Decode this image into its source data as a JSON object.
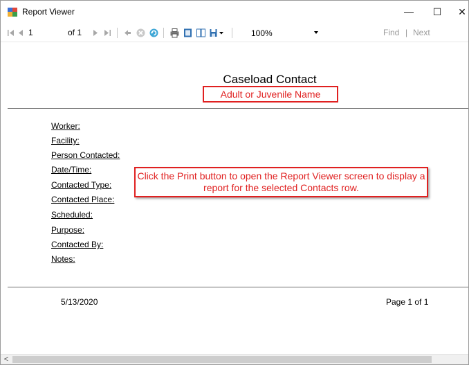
{
  "window": {
    "title": "Report Viewer",
    "minimize_glyph": "—",
    "maximize_glyph": "☐",
    "close_glyph": "✕"
  },
  "toolbar": {
    "first_page_icon": "first-page-icon",
    "prev_page_icon": "previous-page-icon",
    "current_page": "1",
    "of_pages": "of 1",
    "next_page_icon": "next-page-icon",
    "last_page_icon": "last-page-icon",
    "back_icon": "back-icon",
    "stop_icon": "stop-icon",
    "refresh_icon": "refresh-icon",
    "print_icon": "print-icon",
    "print_layout_icon": "print-layout-icon",
    "page_setup_icon": "page-setup-icon",
    "export_icon": "export-icon",
    "zoom": "100%",
    "find_label": "Find",
    "find_separator": "|",
    "next_label": "Next"
  },
  "report": {
    "title": "Caseload Contact",
    "subtitle": "Adult or Juvenile Name",
    "fields": [
      "Worker:",
      "Facility:",
      "Person Contacted:",
      "Date/Time:",
      "Contacted Type:",
      "Contacted Place:",
      "Scheduled:",
      "Purpose:",
      "Contacted By:",
      "Notes:"
    ],
    "callout": "Click the Print button to open the Report Viewer screen to display a report for the selected Contacts row.",
    "footer_date": "5/13/2020",
    "footer_page": "Page 1 of 1"
  },
  "scrollbar": {
    "left_arrow": "<"
  },
  "colors": {
    "annotation_red": "#e02020",
    "rule_gray": "#6e6e6e"
  }
}
